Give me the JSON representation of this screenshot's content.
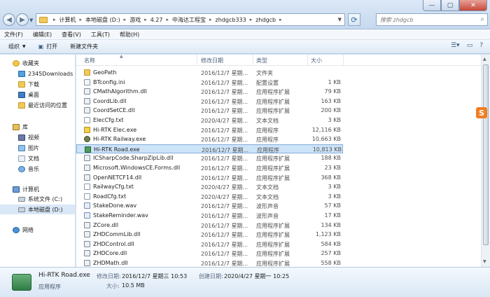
{
  "address": {
    "crumbs": [
      "计算机",
      "本地磁盘 (D:)",
      "游戏",
      "4.27",
      "中海达工程宝",
      "zhdgcb333",
      "zhdgcb"
    ]
  },
  "search": {
    "placeholder": "搜索 zhdgcb"
  },
  "menu": {
    "items": [
      "文件(F)",
      "编辑(E)",
      "查看(V)",
      "工具(T)",
      "帮助(H)"
    ]
  },
  "toolbar": {
    "organize": "组织",
    "open": "打开",
    "new_folder": "新建文件夹"
  },
  "nav": {
    "favorites": "收藏夹",
    "fav_items": [
      "2345Downloads",
      "下载",
      "桌面",
      "最近访问的位置"
    ],
    "library": "库",
    "lib_items": [
      "视频",
      "图片",
      "文档",
      "音乐"
    ],
    "computer": "计算机",
    "comp_items": [
      "系统文件 (C:)",
      "本地磁盘 (D:)"
    ],
    "network": "网络"
  },
  "columns": {
    "name": "名称",
    "date": "修改日期",
    "type": "类型",
    "size": "大小"
  },
  "files": [
    {
      "name": "GeoPath",
      "date": "2016/12/7 星期...",
      "type": "文件夹",
      "size": "",
      "icon": "folder"
    },
    {
      "name": "BTconfig.ini",
      "date": "2016/12/7 星期...",
      "type": "配置设置",
      "size": "1 KB",
      "icon": "ini"
    },
    {
      "name": "CMathAlgorithm.dll",
      "date": "2016/12/7 星期...",
      "type": "应用程序扩展",
      "size": "79 KB",
      "icon": "dll"
    },
    {
      "name": "CoordLib.dll",
      "date": "2016/12/7 星期...",
      "type": "应用程序扩展",
      "size": "163 KB",
      "icon": "dll"
    },
    {
      "name": "CoordSetCE.dll",
      "date": "2016/12/7 星期...",
      "type": "应用程序扩展",
      "size": "200 KB",
      "icon": "dll"
    },
    {
      "name": "ElecCfg.txt",
      "date": "2020/4/27 星期...",
      "type": "文本文档",
      "size": "3 KB",
      "icon": "txt"
    },
    {
      "name": "Hi-RTK Elec.exe",
      "date": "2016/12/7 星期...",
      "type": "应用程序",
      "size": "12,116 KB",
      "icon": "exe-elec"
    },
    {
      "name": "Hi-RTK Railway.exe",
      "date": "2016/12/7 星期...",
      "type": "应用程序",
      "size": "10,663 KB",
      "icon": "exe-rail"
    },
    {
      "name": "Hi-RTK Road.exe",
      "date": "2016/12/7 星期...",
      "type": "应用程序",
      "size": "10,813 KB",
      "icon": "exe-road"
    },
    {
      "name": "ICSharpCode.SharpZipLib.dll",
      "date": "2016/12/7 星期...",
      "type": "应用程序扩展",
      "size": "188 KB",
      "icon": "dll"
    },
    {
      "name": "Microsoft.WindowsCE.Forms.dll",
      "date": "2016/12/7 星期...",
      "type": "应用程序扩展",
      "size": "23 KB",
      "icon": "dll"
    },
    {
      "name": "OpenNETCF14.dll",
      "date": "2016/12/7 星期...",
      "type": "应用程序扩展",
      "size": "368 KB",
      "icon": "dll"
    },
    {
      "name": "RailwayCfg.txt",
      "date": "2020/4/27 星期...",
      "type": "文本文档",
      "size": "3 KB",
      "icon": "txt"
    },
    {
      "name": "RoadCfg.txt",
      "date": "2020/4/27 星期...",
      "type": "文本文档",
      "size": "3 KB",
      "icon": "txt"
    },
    {
      "name": "StakeDone.wav",
      "date": "2016/12/7 星期...",
      "type": "波形声音",
      "size": "57 KB",
      "icon": "wav"
    },
    {
      "name": "StakeReminder.wav",
      "date": "2016/12/7 星期...",
      "type": "波形声音",
      "size": "17 KB",
      "icon": "wav"
    },
    {
      "name": "ZCore.dll",
      "date": "2016/12/7 星期...",
      "type": "应用程序扩展",
      "size": "134 KB",
      "icon": "dll"
    },
    {
      "name": "ZHDCommLib.dll",
      "date": "2016/12/7 星期...",
      "type": "应用程序扩展",
      "size": "1,123 KB",
      "icon": "dll"
    },
    {
      "name": "ZHDControl.dll",
      "date": "2016/12/7 星期...",
      "type": "应用程序扩展",
      "size": "584 KB",
      "icon": "dll"
    },
    {
      "name": "ZHDCore.dll",
      "date": "2016/12/7 星期...",
      "type": "应用程序扩展",
      "size": "257 KB",
      "icon": "dll"
    },
    {
      "name": "ZHDMath.dll",
      "date": "2016/12/7 星期...",
      "type": "应用程序扩展",
      "size": "558 KB",
      "icon": "dll"
    }
  ],
  "selected_index": 8,
  "details": {
    "name": "Hi-RTK Road.exe",
    "type": "应用程序",
    "modified_label": "修改日期:",
    "modified": "2016/12/7 星期三 10:53",
    "created_label": "创建日期:",
    "created": "2020/4/27 星期一 10:25",
    "size_label": "大小:",
    "size": "10.5 MB"
  },
  "badge": "S"
}
